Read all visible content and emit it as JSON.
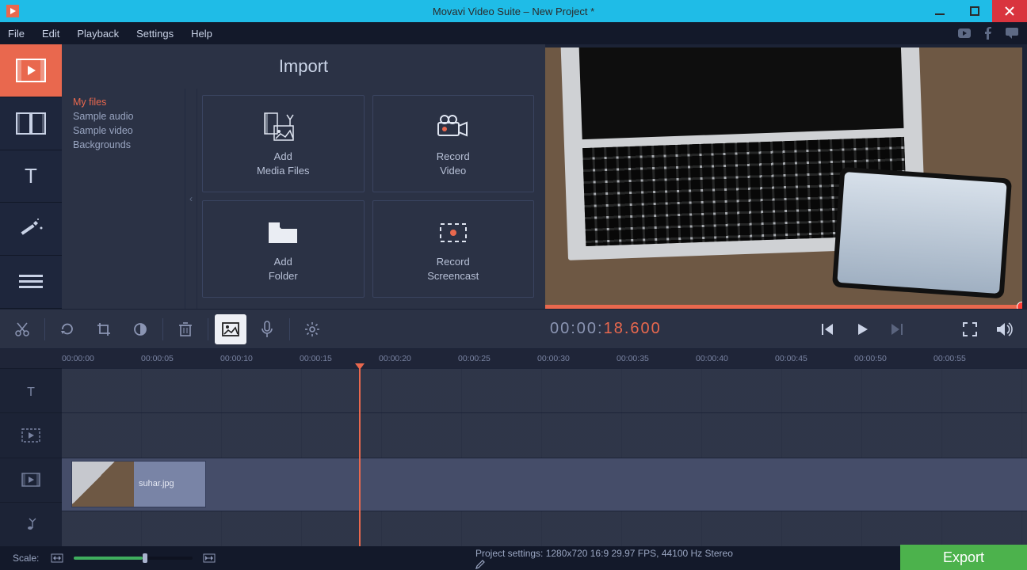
{
  "titlebar": {
    "title": "Movavi Video Suite – New Project *"
  },
  "menus": [
    "File",
    "Edit",
    "Playback",
    "Settings",
    "Help"
  ],
  "vtabs": [
    "import",
    "transitions",
    "titles",
    "effects",
    "more"
  ],
  "import": {
    "heading": "Import",
    "filelist": [
      "My files",
      "Sample audio",
      "Sample video",
      "Backgrounds"
    ],
    "tiles": {
      "add_media": "Add\nMedia Files",
      "record_video": "Record\nVideo",
      "add_folder": "Add\nFolder",
      "record_screencast": "Record\nScreencast"
    }
  },
  "player": {
    "timecode_prefix": "00:00:",
    "timecode_accent": "18.600"
  },
  "ruler": [
    "00:00:00",
    "00:00:05",
    "00:00:10",
    "00:00:15",
    "00:00:20",
    "00:00:25",
    "00:00:30",
    "00:00:35",
    "00:00:40",
    "00:00:45",
    "00:00:50",
    "00:00:55"
  ],
  "clip": {
    "label": "suhar.jpg"
  },
  "footer": {
    "scale_label": "Scale:",
    "project_settings": "Project settings:  1280x720 16:9 29.97 FPS, 44100 Hz Stereo",
    "export": "Export"
  }
}
